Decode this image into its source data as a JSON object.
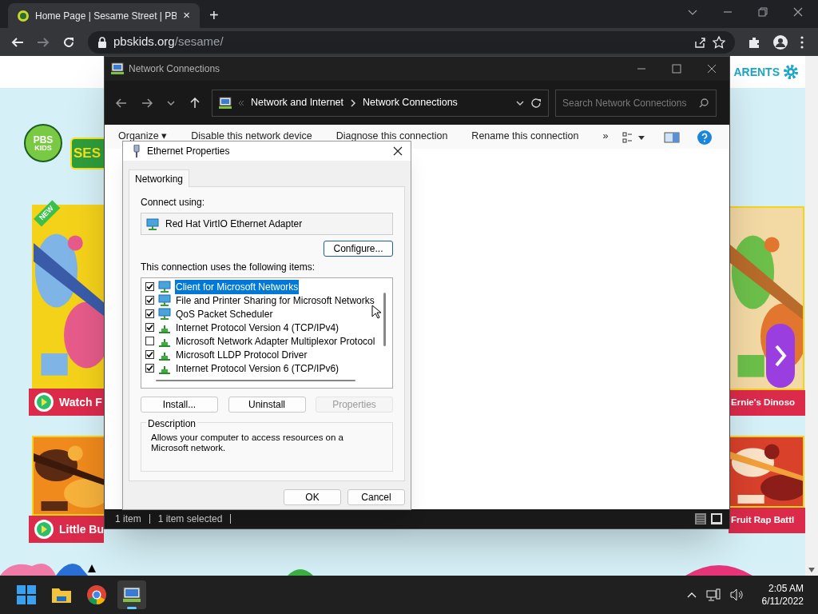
{
  "browser": {
    "tab": {
      "title": "Home Page | Sesame Street | PB",
      "close": "×"
    },
    "new_tab": "+",
    "url_host": "pbskids.org",
    "url_path": "/sesame/"
  },
  "page": {
    "header": {
      "link": "ARENTS"
    },
    "logo": {
      "top": "PBS",
      "bottom": "KIDS"
    },
    "show_logo": "SES",
    "cards_left": [
      {
        "badge": "NEW",
        "label": "Watch F"
      },
      {
        "label": "Little Bu"
      }
    ],
    "cards_right": [
      {
        "label": "Ernie's Dinoso",
        "next_button": true
      },
      {
        "label": "Fruit Rap Battl"
      }
    ]
  },
  "explorer": {
    "title": "Network Connections",
    "breadcrumb": [
      "Network and Internet",
      "Network Connections"
    ],
    "search": {
      "placeholder": "Search Network Connections"
    },
    "commands": [
      "Organize ▾",
      "Disable this network device",
      "Diagnose this connection",
      "Rename this connection",
      "»"
    ],
    "status_bar": [
      "1 item",
      "1 item selected"
    ]
  },
  "dialog": {
    "title": "Ethernet Properties",
    "tabs": [
      {
        "label": "Networking",
        "selected": true
      }
    ],
    "connect_label": "Connect using:",
    "adapter": "Red Hat VirtIO Ethernet Adapter",
    "configure": "Configure...",
    "items_label": "This connection uses the following items:",
    "items": [
      {
        "kind": "service",
        "label": "Client for Microsoft Networks",
        "checked": true,
        "selected": true
      },
      {
        "kind": "service",
        "label": "File and Printer Sharing for Microsoft Networks",
        "checked": true,
        "selected": false
      },
      {
        "kind": "service",
        "label": "QoS Packet Scheduler",
        "checked": true,
        "selected": false
      },
      {
        "kind": "protocol",
        "label": "Internet Protocol Version 4 (TCP/IPv4)",
        "checked": true,
        "selected": false
      },
      {
        "kind": "protocol",
        "label": "Microsoft Network Adapter Multiplexor Protocol",
        "checked": false,
        "selected": false
      },
      {
        "kind": "protocol",
        "label": "Microsoft LLDP Protocol Driver",
        "checked": true,
        "selected": false
      },
      {
        "kind": "protocol",
        "label": "Internet Protocol Version 6 (TCP/IPv6)",
        "checked": true,
        "selected": false
      }
    ],
    "item_buttons": [
      {
        "label": "Install...",
        "disabled": false
      },
      {
        "label": "Uninstall",
        "disabled": false
      },
      {
        "label": "Properties",
        "disabled": true
      }
    ],
    "description_title": "Description",
    "description": "Allows your computer to access resources on a Microsoft network.",
    "buttons": [
      "OK",
      "Cancel"
    ]
  },
  "taskbar": {
    "time": "2:05 AM",
    "date": "6/11/2022"
  }
}
